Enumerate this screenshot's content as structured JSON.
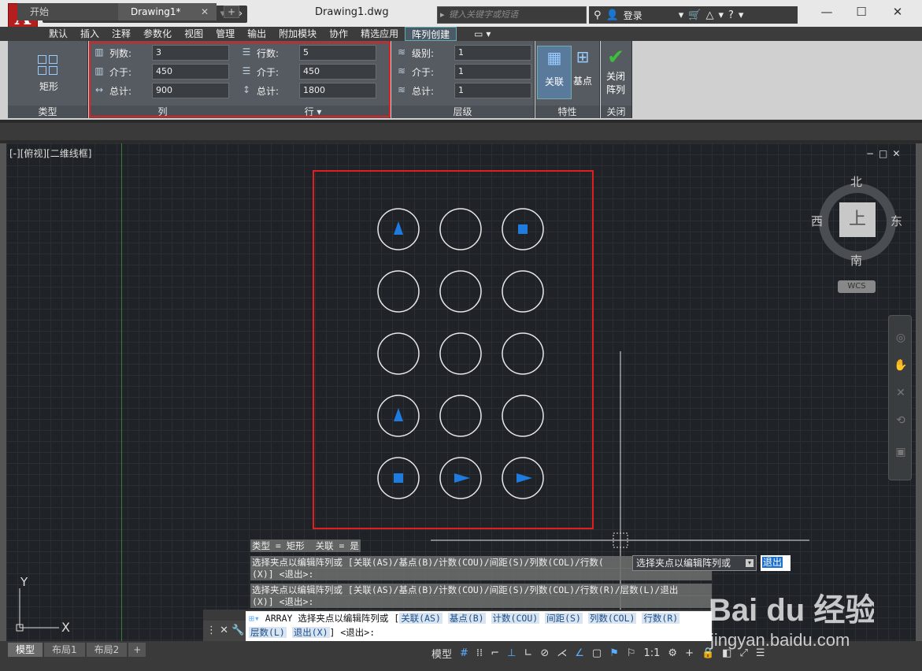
{
  "app": {
    "logo_letter": "A",
    "document_title": "Drawing1.dwg",
    "search_placeholder": "键入关键字或短语",
    "login_label": "登录"
  },
  "ribbon_tabs": [
    "默认",
    "插入",
    "注释",
    "参数化",
    "视图",
    "管理",
    "输出",
    "附加模块",
    "协作",
    "精选应用",
    "阵列创建"
  ],
  "ribbon": {
    "type_panel": {
      "button_label": "矩形",
      "panel_label": "类型"
    },
    "columns_panel": {
      "panel_label": "列",
      "rows": [
        {
          "label": "列数:",
          "value": "3"
        },
        {
          "label": "介于:",
          "value": "450"
        },
        {
          "label": "总计:",
          "value": "900"
        }
      ]
    },
    "rows_panel": {
      "panel_label": "行 ▾",
      "rows": [
        {
          "label": "行数:",
          "value": "5"
        },
        {
          "label": "介于:",
          "value": "450"
        },
        {
          "label": "总计:",
          "value": "1800"
        }
      ]
    },
    "levels_panel": {
      "panel_label": "层级",
      "rows": [
        {
          "label": "级别:",
          "value": "1"
        },
        {
          "label": "介于:",
          "value": "1"
        },
        {
          "label": "总计:",
          "value": "1"
        }
      ]
    },
    "properties_panel": {
      "panel_label": "特性",
      "associative_label": "关联",
      "basepoint_label": "基点"
    },
    "close_panel": {
      "panel_label": "关闭",
      "close_label_line1": "关闭",
      "close_label_line2": "阵列"
    }
  },
  "doc_tabs": {
    "start": "开始",
    "drawing": "Drawing1*"
  },
  "viewport": {
    "label": "[-][俯视][二维线框]"
  },
  "viewcube": {
    "north": "北",
    "south": "南",
    "east": "东",
    "west": "西",
    "face": "上",
    "wcs": "WCS"
  },
  "ucs": {
    "x": "X",
    "y": "Y"
  },
  "command": {
    "history": [
      "类型 = 矩形  关联 = 是",
      "选择夹点以编辑阵列或 [关联(AS)/基点(B)/计数(COU)/间距(S)/列数(COL)/行数(",
      "(X)] <退出>:",
      "选择夹点以编辑阵列或 [关联(AS)/基点(B)/计数(COU)/间距(S)/列数(COL)/行数(R)/层数(L)/退出",
      "(X)] <退出>:"
    ],
    "prompt_prefix": "ARRAY 选择夹点以编辑阵列或 [",
    "options_line1": [
      "关联(AS)",
      "基点(B)",
      "计数(COU)",
      "间距(S)",
      "列数(COL)",
      "行数(R)"
    ],
    "options_line2": [
      "层数(L)",
      "退出(X)"
    ],
    "prompt_suffix": "] <退出>:",
    "tooltip": "选择夹点以编辑阵列或",
    "exit_option": "退出"
  },
  "layout_tabs": [
    "模型",
    "布局1",
    "布局2"
  ],
  "status": {
    "model_label": "模型",
    "scale": "1:1"
  },
  "array": {
    "columns": 3,
    "rows": 5,
    "grips": [
      {
        "row": 0,
        "col": 0,
        "type": "triangle-up"
      },
      {
        "row": 0,
        "col": 2,
        "type": "square"
      },
      {
        "row": 3,
        "col": 0,
        "type": "triangle-up"
      },
      {
        "row": 4,
        "col": 0,
        "type": "square"
      },
      {
        "row": 4,
        "col": 1,
        "type": "triangle-right"
      },
      {
        "row": 4,
        "col": 2,
        "type": "triangle-right"
      }
    ]
  },
  "watermark": {
    "brand": "Bai du 经验",
    "url": "jingyan.baidu.com"
  },
  "colors": {
    "highlight": "#e02020",
    "grip": "#1e7be0",
    "accent": "#5ab0ff"
  }
}
